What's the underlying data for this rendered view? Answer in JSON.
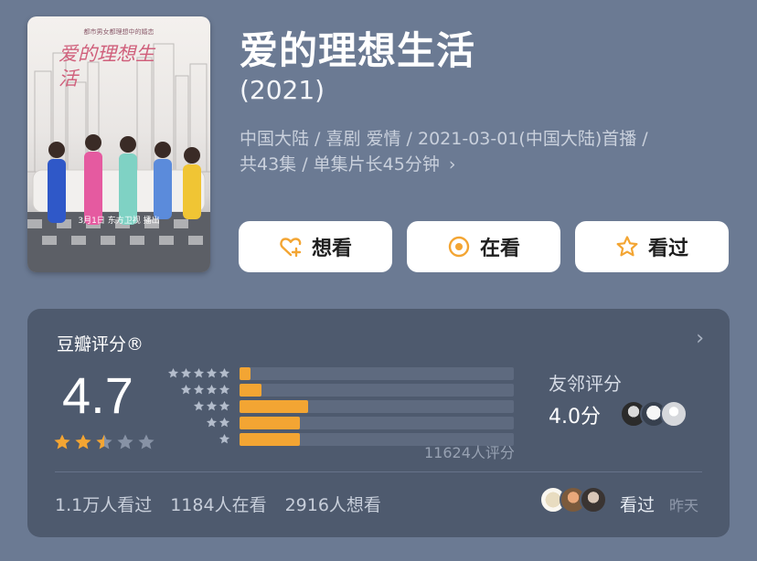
{
  "movie": {
    "title": "爱的理想生活",
    "year": "(2021)",
    "meta_line1": "中国大陆 / 喜剧 爱情 / 2021-03-01(中国大陆)首播 /",
    "meta_line2": "共43集 / 单集片长45分钟",
    "meta_arrow": "›",
    "poster": {
      "title_art": "爱的理想生活",
      "tagline": "都市男女都理想中的婚恋",
      "date_text": "3月1日 东方卫视 播出"
    }
  },
  "actions": {
    "want": "想看",
    "watching": "在看",
    "watched": "看过"
  },
  "rating_card": {
    "title": "豆瓣评分®",
    "chevron": "›",
    "score": "4.7",
    "avg_stars": 2.5,
    "distribution_percent": [
      3,
      8,
      25,
      22,
      22
    ],
    "rating_count": "11624人评分",
    "friend_label": "友邻评分",
    "friend_score": "4.0分",
    "stats": [
      "1.1万人看过",
      "1184人在看",
      "2916人想看"
    ],
    "seen_label": "看过",
    "seen_time": "昨天"
  },
  "colors": {
    "background": "#6b7a93",
    "card": "#4e5a6e",
    "accent_orange": "#f3a533",
    "button_bg": "#ffffff"
  },
  "icons": [
    "heart-plus-icon",
    "target-icon",
    "star-outline-icon",
    "chevron-right-icon",
    "star-icon"
  ]
}
